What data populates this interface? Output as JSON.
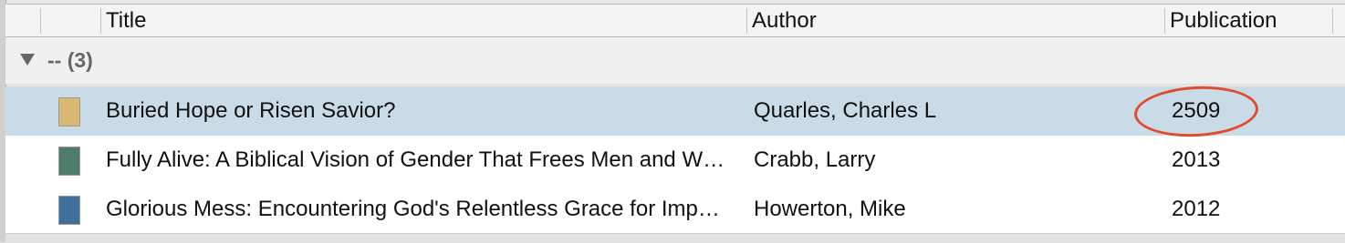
{
  "columns": {
    "title": "Title",
    "author": "Author",
    "publication": "Publication"
  },
  "group": {
    "label": "-- (3)"
  },
  "rows": [
    {
      "title": "Buried Hope or Risen Savior?",
      "author": "Quarles, Charles L",
      "publication": "2509",
      "selected": true,
      "cover_color": "#d8b874"
    },
    {
      "title": "Fully Alive: A Biblical Vision of Gender That Frees Men and W…",
      "author": "Crabb, Larry",
      "publication": "2013",
      "selected": false,
      "cover_color": "#4f7b6a"
    },
    {
      "title": "Glorious Mess: Encountering God's Relentless Grace for Imp…",
      "author": "Howerton, Mike",
      "publication": "2012",
      "selected": false,
      "cover_color": "#3f6f9b"
    }
  ],
  "colors": {
    "selection": "#c9dbe6",
    "annotation": "#e24a2f"
  }
}
